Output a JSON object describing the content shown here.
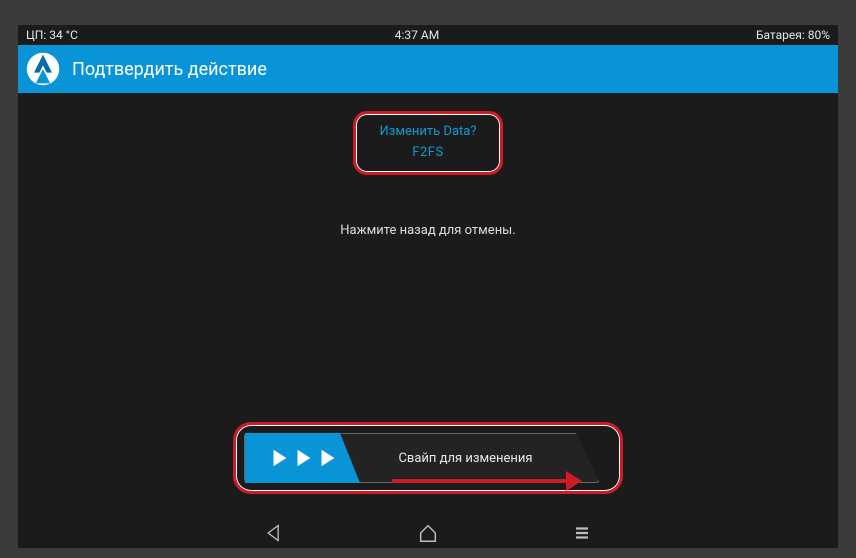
{
  "statusbar": {
    "cpu": "ЦП: 34 °C",
    "time": "4:37 AM",
    "battery": "Батарея: 80%"
  },
  "header": {
    "title": "Подтвердить действие"
  },
  "confirm": {
    "question": "Изменить Data?",
    "value": "F2FS",
    "back_hint": "Нажмите назад для отмены."
  },
  "slider": {
    "label": "Свайп для изменения"
  },
  "icons": {
    "logo": "twrp-logo",
    "play": "play-triangle",
    "back": "nav-back",
    "home": "nav-home",
    "menu": "nav-menu"
  }
}
